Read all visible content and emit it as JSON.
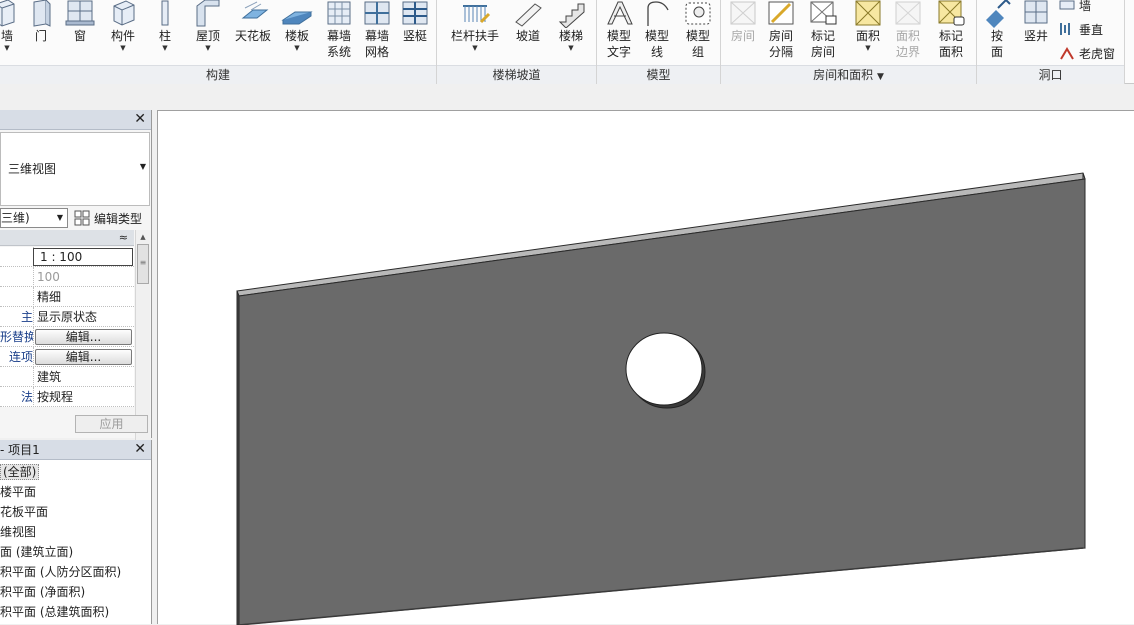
{
  "ribbon": {
    "panels": {
      "build": "构建",
      "stairs": "楼梯坡道",
      "model": "模型",
      "room": "房间和面积",
      "room_arrow": "▼",
      "opening": "洞口"
    },
    "tools": {
      "wall": "墙",
      "door": "门",
      "window": "窗",
      "component": "构件",
      "column": "柱",
      "roof": "屋顶",
      "ceiling": "天花板",
      "floor": "楼板",
      "curtain_system_1": "幕墙",
      "curtain_system_2": "系统",
      "curtain_grid_1": "幕墙",
      "curtain_grid_2": "网格",
      "mullion": "竖梃",
      "railing": "栏杆扶手",
      "ramp": "坡道",
      "stair": "楼梯",
      "model_text_1": "模型",
      "model_text_2": "文字",
      "model_line_1": "模型",
      "model_line_2": "线",
      "model_group_1": "模型",
      "model_group_2": "组",
      "room": "房间",
      "room_sep_1": "房间",
      "room_sep_2": "分隔",
      "tag_room_1": "标记",
      "tag_room_2": "房间",
      "area": "面积",
      "area_boundary_1": "面积",
      "area_boundary_2": "边界",
      "tag_area_1": "标记",
      "tag_area_2": "面积",
      "by_face_1": "按",
      "by_face_2": "面",
      "shaft": "竖井",
      "wall_opening": "墙",
      "vertical": "垂直",
      "dormer": "老虎窗"
    }
  },
  "properties": {
    "close": "✕",
    "type_name": "三维视图",
    "instance_filter": "三维)",
    "edit_type": "编辑类型",
    "collapse": "≈",
    "rows": [
      {
        "key": "",
        "value": "1 : 100"
      },
      {
        "key": "",
        "value": "100"
      },
      {
        "key": "",
        "value": "精细"
      },
      {
        "key": "主",
        "value": "显示原状态"
      },
      {
        "key": "形替换",
        "value": "编辑..."
      },
      {
        "key": "连项",
        "value": "编辑..."
      },
      {
        "key": "",
        "value": "建筑"
      },
      {
        "key": "法",
        "value": "按规程"
      }
    ],
    "apply": "应用"
  },
  "browser": {
    "title": "- 项目1",
    "close": "✕",
    "items": [
      "(全部)",
      "楼平面",
      "花板平面",
      "维视图",
      "面 (建筑立面)",
      "积平面 (人防分区面积)",
      "积平面 (净面积)",
      "积平面 (总建筑面积)"
    ]
  },
  "colors": {
    "wall_face": "#6a6a6a",
    "wall_top": "#b9b9b9",
    "wall_edge": "#2a2a2a",
    "canvas_bg": "#ffffff"
  }
}
